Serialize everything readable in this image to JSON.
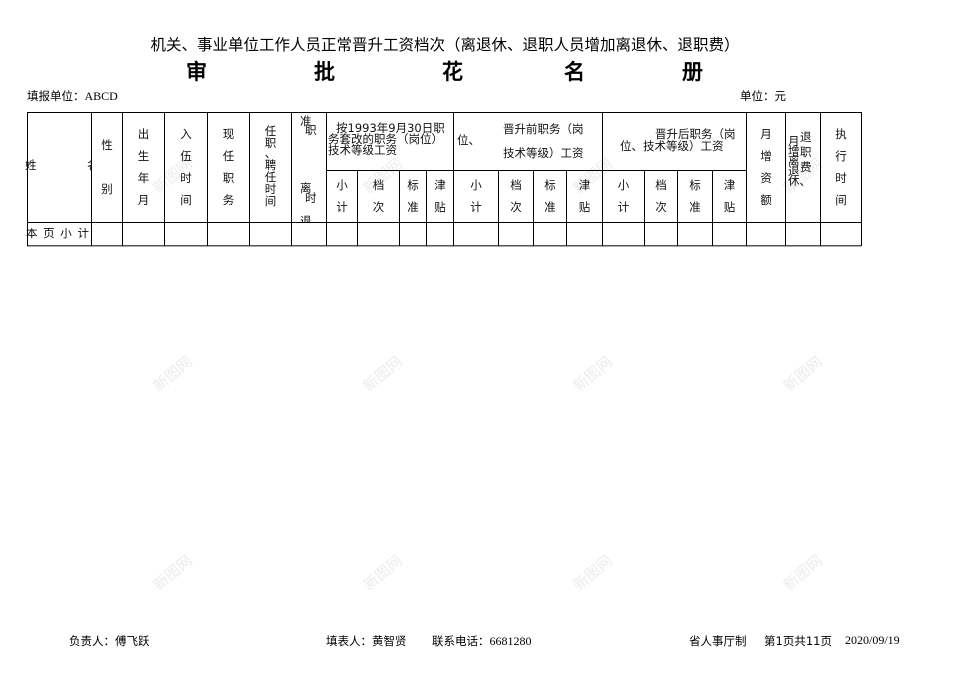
{
  "document": {
    "title_line1": "机关、事业单位工作人员正常晋升工资档次（离退休、退职人员增加离退休、退职费）",
    "title_line2_chars": [
      "审",
      "批",
      "花",
      "名",
      "册"
    ],
    "reporting_unit_label": "填报单位：",
    "reporting_unit_value": "ABCD",
    "currency_unit_label": "单位：",
    "currency_unit_value": "元"
  },
  "table": {
    "headers": {
      "name": [
        "姓",
        "名"
      ],
      "gender": [
        "性",
        "别"
      ],
      "birth": [
        "出",
        "生",
        "年",
        "月"
      ],
      "enlist": [
        "入",
        "伍",
        "时",
        "间"
      ],
      "current_post": [
        "现",
        "任",
        "职",
        "务"
      ],
      "appoint_time": [
        "任",
        "职",
        "、",
        "聘",
        "任",
        "时",
        "间"
      ],
      "approve_retire": [
        "准",
        "职",
        "离",
        "时",
        "退"
      ],
      "group1": "按1993年9月30日职务套改的职务（岗位）技术等级工资",
      "group2_line1": "晋升前职务（岗",
      "group2_prefix": "位、",
      "group2_line2": "技术等级）工资",
      "group3_line1": "晋升后职务（岗",
      "group3_line2": "位、技术等级）工资",
      "monthly_increase": [
        "月",
        "增",
        "资",
        "额"
      ],
      "retire_increase": [
        "月增离退休、",
        "退职费"
      ],
      "exec_time": [
        "执",
        "行",
        "时",
        "间"
      ],
      "sub_columns": [
        [
          "小",
          "计"
        ],
        [
          "档",
          "次"
        ],
        [
          "标",
          "准"
        ],
        [
          "津",
          "贴"
        ]
      ]
    },
    "subtotal_row_label": "本 页 小 计",
    "subtotal_row_values": [
      "",
      "",
      "",
      "",
      "",
      "",
      "",
      "",
      "",
      "",
      "",
      "",
      "",
      "",
      "",
      "",
      "",
      "",
      "",
      ""
    ]
  },
  "footer": {
    "responsible_label": "负责人：",
    "responsible_name": "傅飞跃",
    "filler_label": "填表人：",
    "filler_name": "黄智贤",
    "phone_label": "联系电话：",
    "phone_value": "6681280",
    "issuer": "省人事厅制",
    "page_info": "第1页共11页",
    "date": "2020/09/19"
  },
  "watermark": {
    "text": "新图网",
    "color": "#ececec"
  }
}
